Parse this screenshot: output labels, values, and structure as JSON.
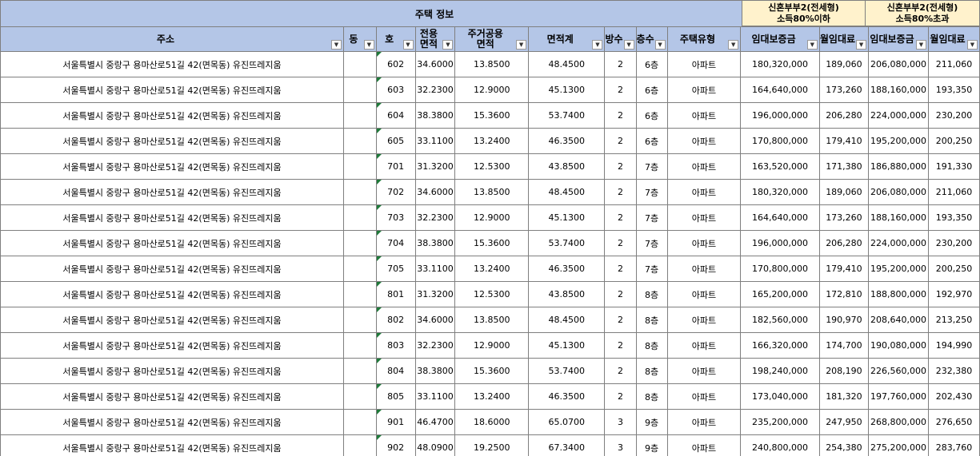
{
  "header": {
    "group_housing": "주택 정보",
    "group_tier1_line1": "신혼부부2(전세형)",
    "group_tier1_line2": "소득80%이하",
    "group_tier2_line1": "신혼부부2(전세형)",
    "group_tier2_line2": "소득80%초과",
    "columns": {
      "address": "주소",
      "dong": "동",
      "ho": "호",
      "area_excl_1": "전용",
      "area_excl_2": "면적",
      "area_common_1": "주거공용",
      "area_common_2": "면적",
      "area_total": "면적계",
      "rooms": "방수",
      "floor": "층수",
      "type": "주택유형",
      "deposit1": "임대보증금",
      "rent1": "월임대료",
      "deposit2": "임대보증금",
      "rent2": "월임대료"
    },
    "filter_icon": "filter-dropdown-icon"
  },
  "rows": [
    {
      "address": "서울특별시 중랑구 용마산로51길 42(면목동) 유진뜨레지움",
      "dong": "",
      "ho": "602",
      "area_excl": "34.6000",
      "area_common": "13.8500",
      "area_total": "48.4500",
      "rooms": "2",
      "floor": "6층",
      "type": "아파트",
      "deposit1": "180,320,000",
      "rent1": "189,060",
      "deposit2": "206,080,000",
      "rent2": "211,060"
    },
    {
      "address": "서울특별시 중랑구 용마산로51길 42(면목동) 유진뜨레지움",
      "dong": "",
      "ho": "603",
      "area_excl": "32.2300",
      "area_common": "12.9000",
      "area_total": "45.1300",
      "rooms": "2",
      "floor": "6층",
      "type": "아파트",
      "deposit1": "164,640,000",
      "rent1": "173,260",
      "deposit2": "188,160,000",
      "rent2": "193,350"
    },
    {
      "address": "서울특별시 중랑구 용마산로51길 42(면목동) 유진뜨레지움",
      "dong": "",
      "ho": "604",
      "area_excl": "38.3800",
      "area_common": "15.3600",
      "area_total": "53.7400",
      "rooms": "2",
      "floor": "6층",
      "type": "아파트",
      "deposit1": "196,000,000",
      "rent1": "206,280",
      "deposit2": "224,000,000",
      "rent2": "230,200"
    },
    {
      "address": "서울특별시 중랑구 용마산로51길 42(면목동) 유진뜨레지움",
      "dong": "",
      "ho": "605",
      "area_excl": "33.1100",
      "area_common": "13.2400",
      "area_total": "46.3500",
      "rooms": "2",
      "floor": "6층",
      "type": "아파트",
      "deposit1": "170,800,000",
      "rent1": "179,410",
      "deposit2": "195,200,000",
      "rent2": "200,250"
    },
    {
      "address": "서울특별시 중랑구 용마산로51길 42(면목동) 유진뜨레지움",
      "dong": "",
      "ho": "701",
      "area_excl": "31.3200",
      "area_common": "12.5300",
      "area_total": "43.8500",
      "rooms": "2",
      "floor": "7층",
      "type": "아파트",
      "deposit1": "163,520,000",
      "rent1": "171,380",
      "deposit2": "186,880,000",
      "rent2": "191,330"
    },
    {
      "address": "서울특별시 중랑구 용마산로51길 42(면목동) 유진뜨레지움",
      "dong": "",
      "ho": "702",
      "area_excl": "34.6000",
      "area_common": "13.8500",
      "area_total": "48.4500",
      "rooms": "2",
      "floor": "7층",
      "type": "아파트",
      "deposit1": "180,320,000",
      "rent1": "189,060",
      "deposit2": "206,080,000",
      "rent2": "211,060"
    },
    {
      "address": "서울특별시 중랑구 용마산로51길 42(면목동) 유진뜨레지움",
      "dong": "",
      "ho": "703",
      "area_excl": "32.2300",
      "area_common": "12.9000",
      "area_total": "45.1300",
      "rooms": "2",
      "floor": "7층",
      "type": "아파트",
      "deposit1": "164,640,000",
      "rent1": "173,260",
      "deposit2": "188,160,000",
      "rent2": "193,350"
    },
    {
      "address": "서울특별시 중랑구 용마산로51길 42(면목동) 유진뜨레지움",
      "dong": "",
      "ho": "704",
      "area_excl": "38.3800",
      "area_common": "15.3600",
      "area_total": "53.7400",
      "rooms": "2",
      "floor": "7층",
      "type": "아파트",
      "deposit1": "196,000,000",
      "rent1": "206,280",
      "deposit2": "224,000,000",
      "rent2": "230,200"
    },
    {
      "address": "서울특별시 중랑구 용마산로51길 42(면목동) 유진뜨레지움",
      "dong": "",
      "ho": "705",
      "area_excl": "33.1100",
      "area_common": "13.2400",
      "area_total": "46.3500",
      "rooms": "2",
      "floor": "7층",
      "type": "아파트",
      "deposit1": "170,800,000",
      "rent1": "179,410",
      "deposit2": "195,200,000",
      "rent2": "200,250"
    },
    {
      "address": "서울특별시 중랑구 용마산로51길 42(면목동) 유진뜨레지움",
      "dong": "",
      "ho": "801",
      "area_excl": "31.3200",
      "area_common": "12.5300",
      "area_total": "43.8500",
      "rooms": "2",
      "floor": "8층",
      "type": "아파트",
      "deposit1": "165,200,000",
      "rent1": "172,810",
      "deposit2": "188,800,000",
      "rent2": "192,970"
    },
    {
      "address": "서울특별시 중랑구 용마산로51길 42(면목동) 유진뜨레지움",
      "dong": "",
      "ho": "802",
      "area_excl": "34.6000",
      "area_common": "13.8500",
      "area_total": "48.4500",
      "rooms": "2",
      "floor": "8층",
      "type": "아파트",
      "deposit1": "182,560,000",
      "rent1": "190,970",
      "deposit2": "208,640,000",
      "rent2": "213,250"
    },
    {
      "address": "서울특별시 중랑구 용마산로51길 42(면목동) 유진뜨레지움",
      "dong": "",
      "ho": "803",
      "area_excl": "32.2300",
      "area_common": "12.9000",
      "area_total": "45.1300",
      "rooms": "2",
      "floor": "8층",
      "type": "아파트",
      "deposit1": "166,320,000",
      "rent1": "174,700",
      "deposit2": "190,080,000",
      "rent2": "194,990"
    },
    {
      "address": "서울특별시 중랑구 용마산로51길 42(면목동) 유진뜨레지움",
      "dong": "",
      "ho": "804",
      "area_excl": "38.3800",
      "area_common": "15.3600",
      "area_total": "53.7400",
      "rooms": "2",
      "floor": "8층",
      "type": "아파트",
      "deposit1": "198,240,000",
      "rent1": "208,190",
      "deposit2": "226,560,000",
      "rent2": "232,380"
    },
    {
      "address": "서울특별시 중랑구 용마산로51길 42(면목동) 유진뜨레지움",
      "dong": "",
      "ho": "805",
      "area_excl": "33.1100",
      "area_common": "13.2400",
      "area_total": "46.3500",
      "rooms": "2",
      "floor": "8층",
      "type": "아파트",
      "deposit1": "173,040,000",
      "rent1": "181,320",
      "deposit2": "197,760,000",
      "rent2": "202,430"
    },
    {
      "address": "서울특별시 중랑구 용마산로51길 42(면목동) 유진뜨레지움",
      "dong": "",
      "ho": "901",
      "area_excl": "46.4700",
      "area_common": "18.6000",
      "area_total": "65.0700",
      "rooms": "3",
      "floor": "9층",
      "type": "아파트",
      "deposit1": "235,200,000",
      "rent1": "247,950",
      "deposit2": "268,800,000",
      "rent2": "276,650"
    },
    {
      "address": "서울특별시 중랑구 용마산로51길 42(면목동) 유진뜨레지움",
      "dong": "",
      "ho": "902",
      "area_excl": "48.0900",
      "area_common": "19.2500",
      "area_total": "67.3400",
      "rooms": "3",
      "floor": "9층",
      "type": "아파트",
      "deposit1": "240,800,000",
      "rent1": "254,380",
      "deposit2": "275,200,000",
      "rent2": "283,760"
    }
  ]
}
